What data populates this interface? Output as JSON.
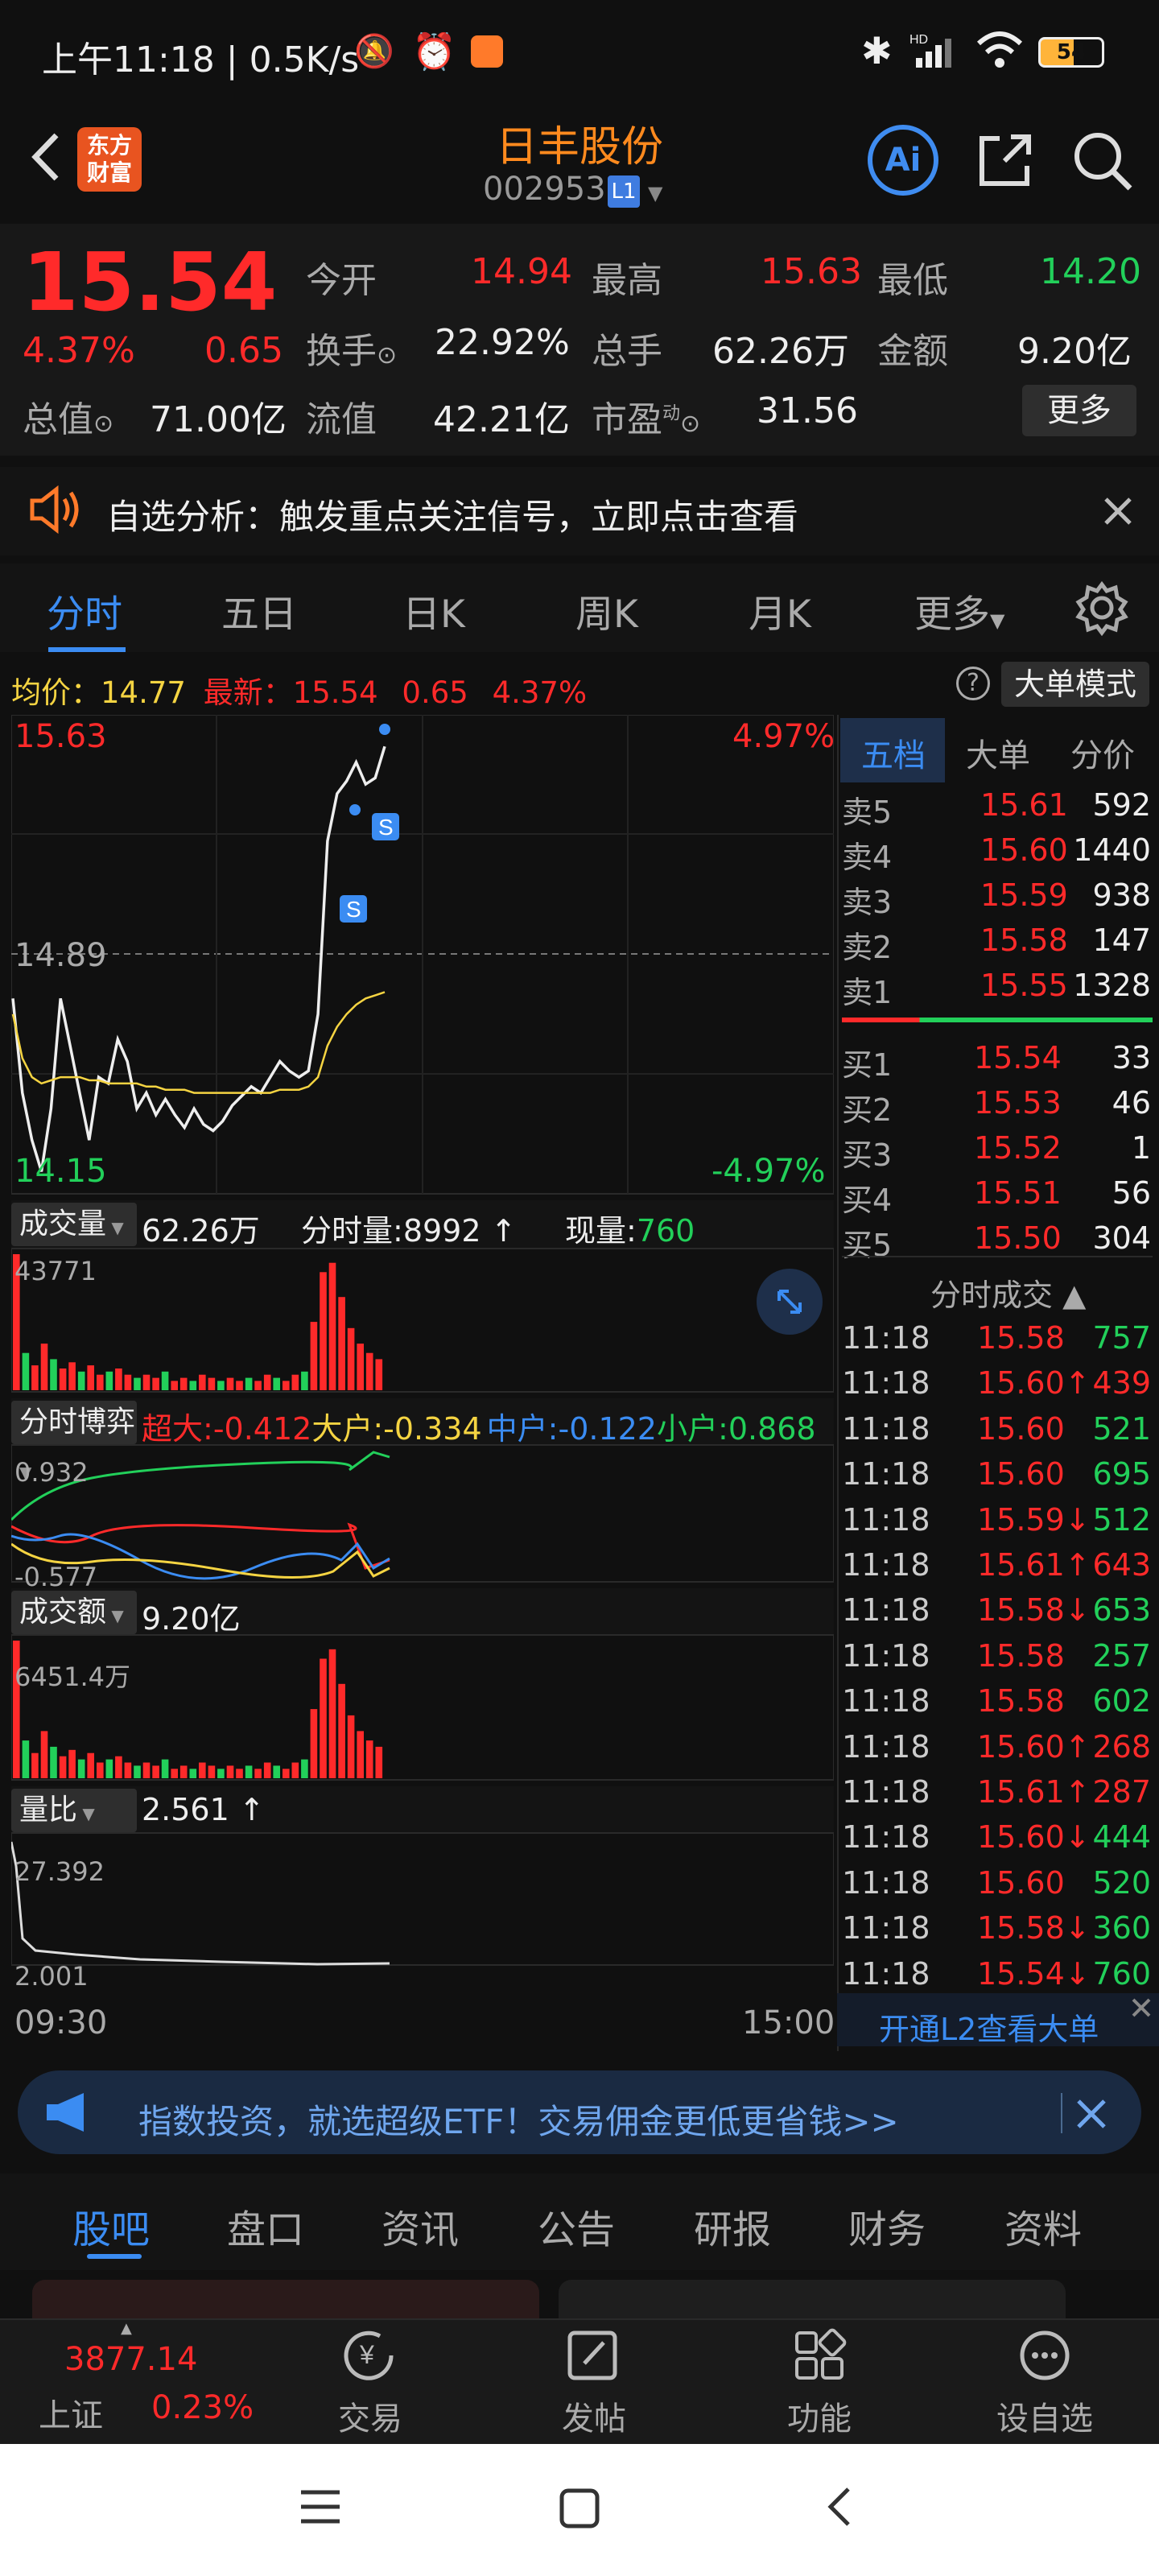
{
  "status": {
    "time": "上午11:18",
    "speed": "0.5K/s",
    "battery": "54",
    "hd": "HD"
  },
  "header": {
    "name": "日丰股份",
    "code": "002953",
    "level": "L1",
    "logo": "东方\n财富"
  },
  "quote": {
    "price": "15.54",
    "pct": "4.37%",
    "chg": "0.65",
    "cells": [
      {
        "label": "今开",
        "value": "14.94",
        "color": "red"
      },
      {
        "label": "最高",
        "value": "15.63",
        "color": "red"
      },
      {
        "label": "最低",
        "value": "14.20",
        "color": "green"
      },
      {
        "label": "换手",
        "value": "22.92%",
        "color": "white"
      },
      {
        "label": "总手",
        "value": "62.26万",
        "color": "white"
      },
      {
        "label": "金额",
        "value": "9.20亿",
        "color": "white"
      },
      {
        "label": "总值",
        "value": "71.00亿",
        "color": "white"
      },
      {
        "label": "流值",
        "value": "42.21亿",
        "color": "white"
      },
      {
        "label": "市盈",
        "value": "31.56",
        "color": "white"
      }
    ],
    "more": "更多",
    "dyn": "动"
  },
  "alert": {
    "text": "自选分析：触发重点关注信号，立即点击查看"
  },
  "chart_tabs": [
    "分时",
    "五日",
    "日K",
    "周K",
    "月K",
    "更多"
  ],
  "info_line": {
    "avg_label": "均价：",
    "avg": "14.77",
    "new_label": "最新：",
    "new": "15.54",
    "chg": "0.65",
    "pct": "4.37%",
    "mode": "大单模式"
  },
  "chart_data": [
    {
      "type": "line",
      "title": "分时",
      "x_start": "09:30",
      "x_end": "15:00",
      "ylim": [
        14.15,
        15.63
      ],
      "y_high_label": "15.63",
      "y_low_label": "14.15",
      "y_mid_label": "14.89",
      "pct_high": "4.97%",
      "pct_low": "-4.97%",
      "series": [
        {
          "name": "最新",
          "values": [
            14.75,
            14.45,
            14.3,
            14.2,
            14.4,
            14.75,
            14.6,
            14.45,
            14.3,
            14.5,
            14.48,
            14.62,
            14.55,
            14.4,
            14.45,
            14.38,
            14.43,
            14.38,
            14.34,
            14.4,
            14.35,
            14.33,
            14.36,
            14.41,
            14.44,
            14.47,
            14.45,
            14.5,
            14.55,
            14.52,
            14.5,
            14.52,
            14.7,
            15.25,
            15.4,
            15.44,
            15.5,
            15.43,
            15.45,
            15.55
          ]
        },
        {
          "name": "均价",
          "values": [
            14.7,
            14.56,
            14.5,
            14.48,
            14.49,
            14.5,
            14.5,
            14.5,
            14.49,
            14.49,
            14.48,
            14.48,
            14.48,
            14.48,
            14.47,
            14.47,
            14.46,
            14.46,
            14.46,
            14.45,
            14.45,
            14.45,
            14.45,
            14.45,
            14.45,
            14.45,
            14.45,
            14.45,
            14.46,
            14.46,
            14.46,
            14.47,
            14.5,
            14.6,
            14.66,
            14.7,
            14.73,
            14.75,
            14.76,
            14.77
          ]
        }
      ]
    },
    {
      "type": "bar",
      "title": "成交量",
      "label_value": "62.26万",
      "ymax": 43771,
      "ymax_label": "43771",
      "values": [
        43771,
        12000,
        8000,
        15000,
        10000,
        7000,
        9000,
        6000,
        8000,
        5000,
        6000,
        7000,
        5000,
        4000,
        5000,
        4000,
        6000,
        3000,
        4000,
        3000,
        5000,
        4000,
        3000,
        4000,
        3000,
        4000,
        3000,
        5000,
        4000,
        3000,
        5000,
        6000,
        22000,
        38000,
        41000,
        30000,
        20000,
        15000,
        12000,
        10000
      ]
    },
    {
      "type": "line",
      "title": "分时博弈",
      "ymax_label": "0.932",
      "ymin_label": "-0.577",
      "series": [
        {
          "name": "超大",
          "value": "-0.412"
        },
        {
          "name": "大户",
          "value": "-0.334"
        },
        {
          "name": "中户",
          "value": "-0.122"
        },
        {
          "name": "小户",
          "value": "0.868"
        }
      ]
    },
    {
      "type": "bar",
      "title": "成交额",
      "label_value": "9.20亿",
      "ymax_label": "6451.4万"
    },
    {
      "type": "line",
      "title": "量比",
      "label_value": "2.561",
      "ymax_label": "27.392",
      "ymin_label": "2.001"
    }
  ],
  "vol_info": {
    "fenshi_label": "分时量:",
    "fenshi": "8992",
    "xian_label": "现量:",
    "xian": "760"
  },
  "orderbook": {
    "tabs": [
      "五档",
      "大单",
      "分价"
    ],
    "sells": [
      {
        "label": "卖5",
        "price": "15.61",
        "vol": "592"
      },
      {
        "label": "卖4",
        "price": "15.60",
        "vol": "1440"
      },
      {
        "label": "卖3",
        "price": "15.59",
        "vol": "938"
      },
      {
        "label": "卖2",
        "price": "15.58",
        "vol": "147"
      },
      {
        "label": "卖1",
        "price": "15.55",
        "vol": "1328"
      }
    ],
    "buys": [
      {
        "label": "买1",
        "price": "15.54",
        "vol": "33"
      },
      {
        "label": "买2",
        "price": "15.53",
        "vol": "46"
      },
      {
        "label": "买3",
        "price": "15.52",
        "vol": "1"
      },
      {
        "label": "买4",
        "price": "15.51",
        "vol": "56"
      },
      {
        "label": "买5",
        "price": "15.50",
        "vol": "304"
      }
    ],
    "trades_title": "分时成交",
    "trades": [
      {
        "time": "11:18",
        "price": "15.58",
        "arrow": "",
        "vol": "757"
      },
      {
        "time": "11:18",
        "price": "15.60",
        "arrow": "↑",
        "vol": "439"
      },
      {
        "time": "11:18",
        "price": "15.60",
        "arrow": "",
        "vol": "521"
      },
      {
        "time": "11:18",
        "price": "15.60",
        "arrow": "",
        "vol": "695"
      },
      {
        "time": "11:18",
        "price": "15.59",
        "arrow": "↓",
        "vol": "512"
      },
      {
        "time": "11:18",
        "price": "15.61",
        "arrow": "↑",
        "vol": "643"
      },
      {
        "time": "11:18",
        "price": "15.58",
        "arrow": "↓",
        "vol": "653"
      },
      {
        "time": "11:18",
        "price": "15.58",
        "arrow": "",
        "vol": "257"
      },
      {
        "time": "11:18",
        "price": "15.58",
        "arrow": "",
        "vol": "602"
      },
      {
        "time": "11:18",
        "price": "15.60",
        "arrow": "↑",
        "vol": "268"
      },
      {
        "time": "11:18",
        "price": "15.61",
        "arrow": "↑",
        "vol": "287"
      },
      {
        "time": "11:18",
        "price": "15.60",
        "arrow": "↓",
        "vol": "444"
      },
      {
        "time": "11:18",
        "price": "15.60",
        "arrow": "",
        "vol": "520"
      },
      {
        "time": "11:18",
        "price": "15.58",
        "arrow": "↓",
        "vol": "360"
      },
      {
        "time": "11:18",
        "price": "15.54",
        "arrow": "↓",
        "vol": "760"
      }
    ],
    "l2": "开通L2查看大单"
  },
  "banner": {
    "text": "指数投资，就选超级ETF！交易佣金更低更省钱>>"
  },
  "bottom_tabs": [
    "股吧",
    "盘口",
    "资讯",
    "公告",
    "研报",
    "财务",
    "资料"
  ],
  "bottom_nav": {
    "index_value": "3877.14",
    "index_name": "上证",
    "index_pct": "0.23%",
    "items": [
      "交易",
      "发帖",
      "功能",
      "设自选"
    ]
  }
}
